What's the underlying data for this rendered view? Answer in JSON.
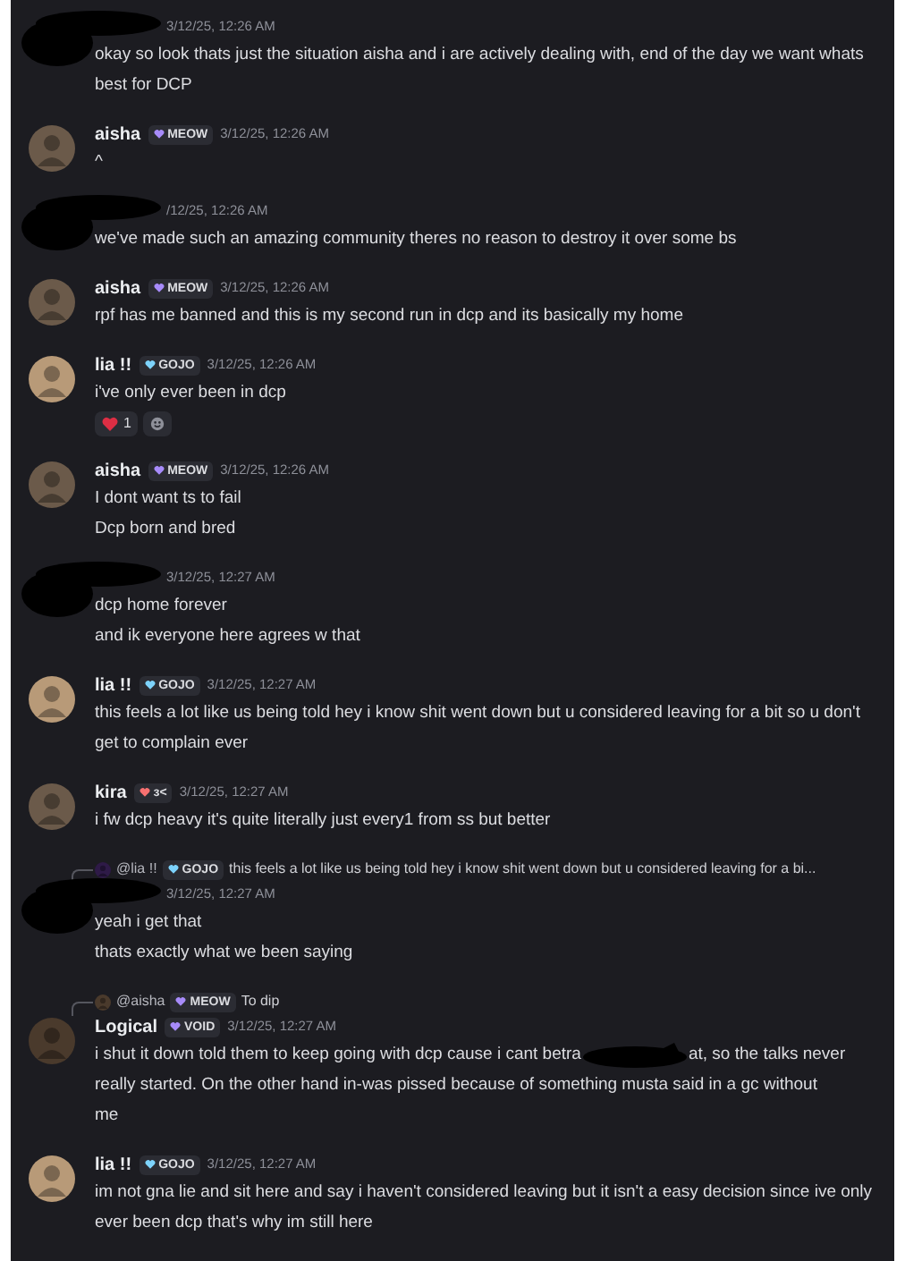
{
  "messages": [
    {
      "redacted": true,
      "timestamp": "3/12/25, 12:26 AM",
      "lines": [
        "okay so look thats just the situation aisha and i are actively dealing with, end of the day we want whats best for DCP"
      ]
    },
    {
      "author": "aisha",
      "badge": {
        "text": "MEOW",
        "color": "#a78bfa"
      },
      "timestamp": "3/12/25, 12:26 AM",
      "lines": [
        "^"
      ]
    },
    {
      "redacted": true,
      "timestamp": "/12/25, 12:26 AM",
      "lines": [
        "we've made such an amazing community theres no reason to destroy it over some bs"
      ]
    },
    {
      "author": "aisha",
      "badge": {
        "text": "MEOW",
        "color": "#a78bfa"
      },
      "timestamp": "3/12/25, 12:26 AM",
      "lines": [
        "rpf has me banned and this is my second run in dcp and its basically my home"
      ]
    },
    {
      "author": "lia !!",
      "badge": {
        "text": "GOJO",
        "color": "#7dd3fc"
      },
      "timestamp": "3/12/25, 12:26 AM",
      "lines": [
        "i've only ever been in dcp"
      ],
      "reactions": [
        {
          "kind": "heart",
          "count": "1"
        },
        {
          "kind": "add"
        }
      ]
    },
    {
      "author": "aisha",
      "badge": {
        "text": "MEOW",
        "color": "#a78bfa"
      },
      "timestamp": "3/12/25, 12:26 AM",
      "lines": [
        "I dont want ts to fail",
        "Dcp born and bred"
      ]
    },
    {
      "redacted": true,
      "timestamp": "3/12/25, 12:27 AM",
      "lines": [
        "dcp home forever",
        "and ik everyone here agrees w that"
      ]
    },
    {
      "author": "lia !!",
      "badge": {
        "text": "GOJO",
        "color": "#7dd3fc"
      },
      "timestamp": "3/12/25, 12:27 AM",
      "lines": [
        "this feels a lot like us being told hey i know shit went down but u considered leaving for a bit so u don't get to complain ever"
      ]
    },
    {
      "author": "kira",
      "badge": {
        "text": "ɜ<",
        "color": "#f87171"
      },
      "timestamp": "3/12/25, 12:27 AM",
      "lines": [
        "i fw dcp heavy it's quite literally just every1 from ss but better"
      ]
    },
    {
      "redacted": true,
      "reply": {
        "name": "@lia !!",
        "badge": {
          "text": "GOJO",
          "color": "#7dd3fc"
        },
        "text": "this feels a lot like us being told hey i know shit went down but u considered leaving for a bi..."
      },
      "timestamp": "3/12/25, 12:27 AM",
      "lines": [
        "yeah i get that",
        "thats exactly what we been saying"
      ]
    },
    {
      "author": "Logical",
      "badge": {
        "text": "VOID",
        "color": "#a78bfa"
      },
      "reply": {
        "name": "@aisha",
        "badge": {
          "text": "MEOW",
          "color": "#a78bfa"
        },
        "text": "To dip"
      },
      "timestamp": "3/12/25, 12:27 AM",
      "lines": [
        {
          "before": "i shut it down told them to keep going with dcp cause i cant betra",
          "after": "at, so the talks never"
        },
        "really started. On the other hand in-was pissed because of something musta said in a gc without",
        "me"
      ]
    },
    {
      "author": "lia !!",
      "badge": {
        "text": "GOJO",
        "color": "#7dd3fc"
      },
      "timestamp": "3/12/25, 12:27 AM",
      "lines": [
        "im not gna lie and sit here and say i haven't considered leaving but it isn't a easy decision since ive only ever been dcp that's why im still here"
      ]
    }
  ]
}
